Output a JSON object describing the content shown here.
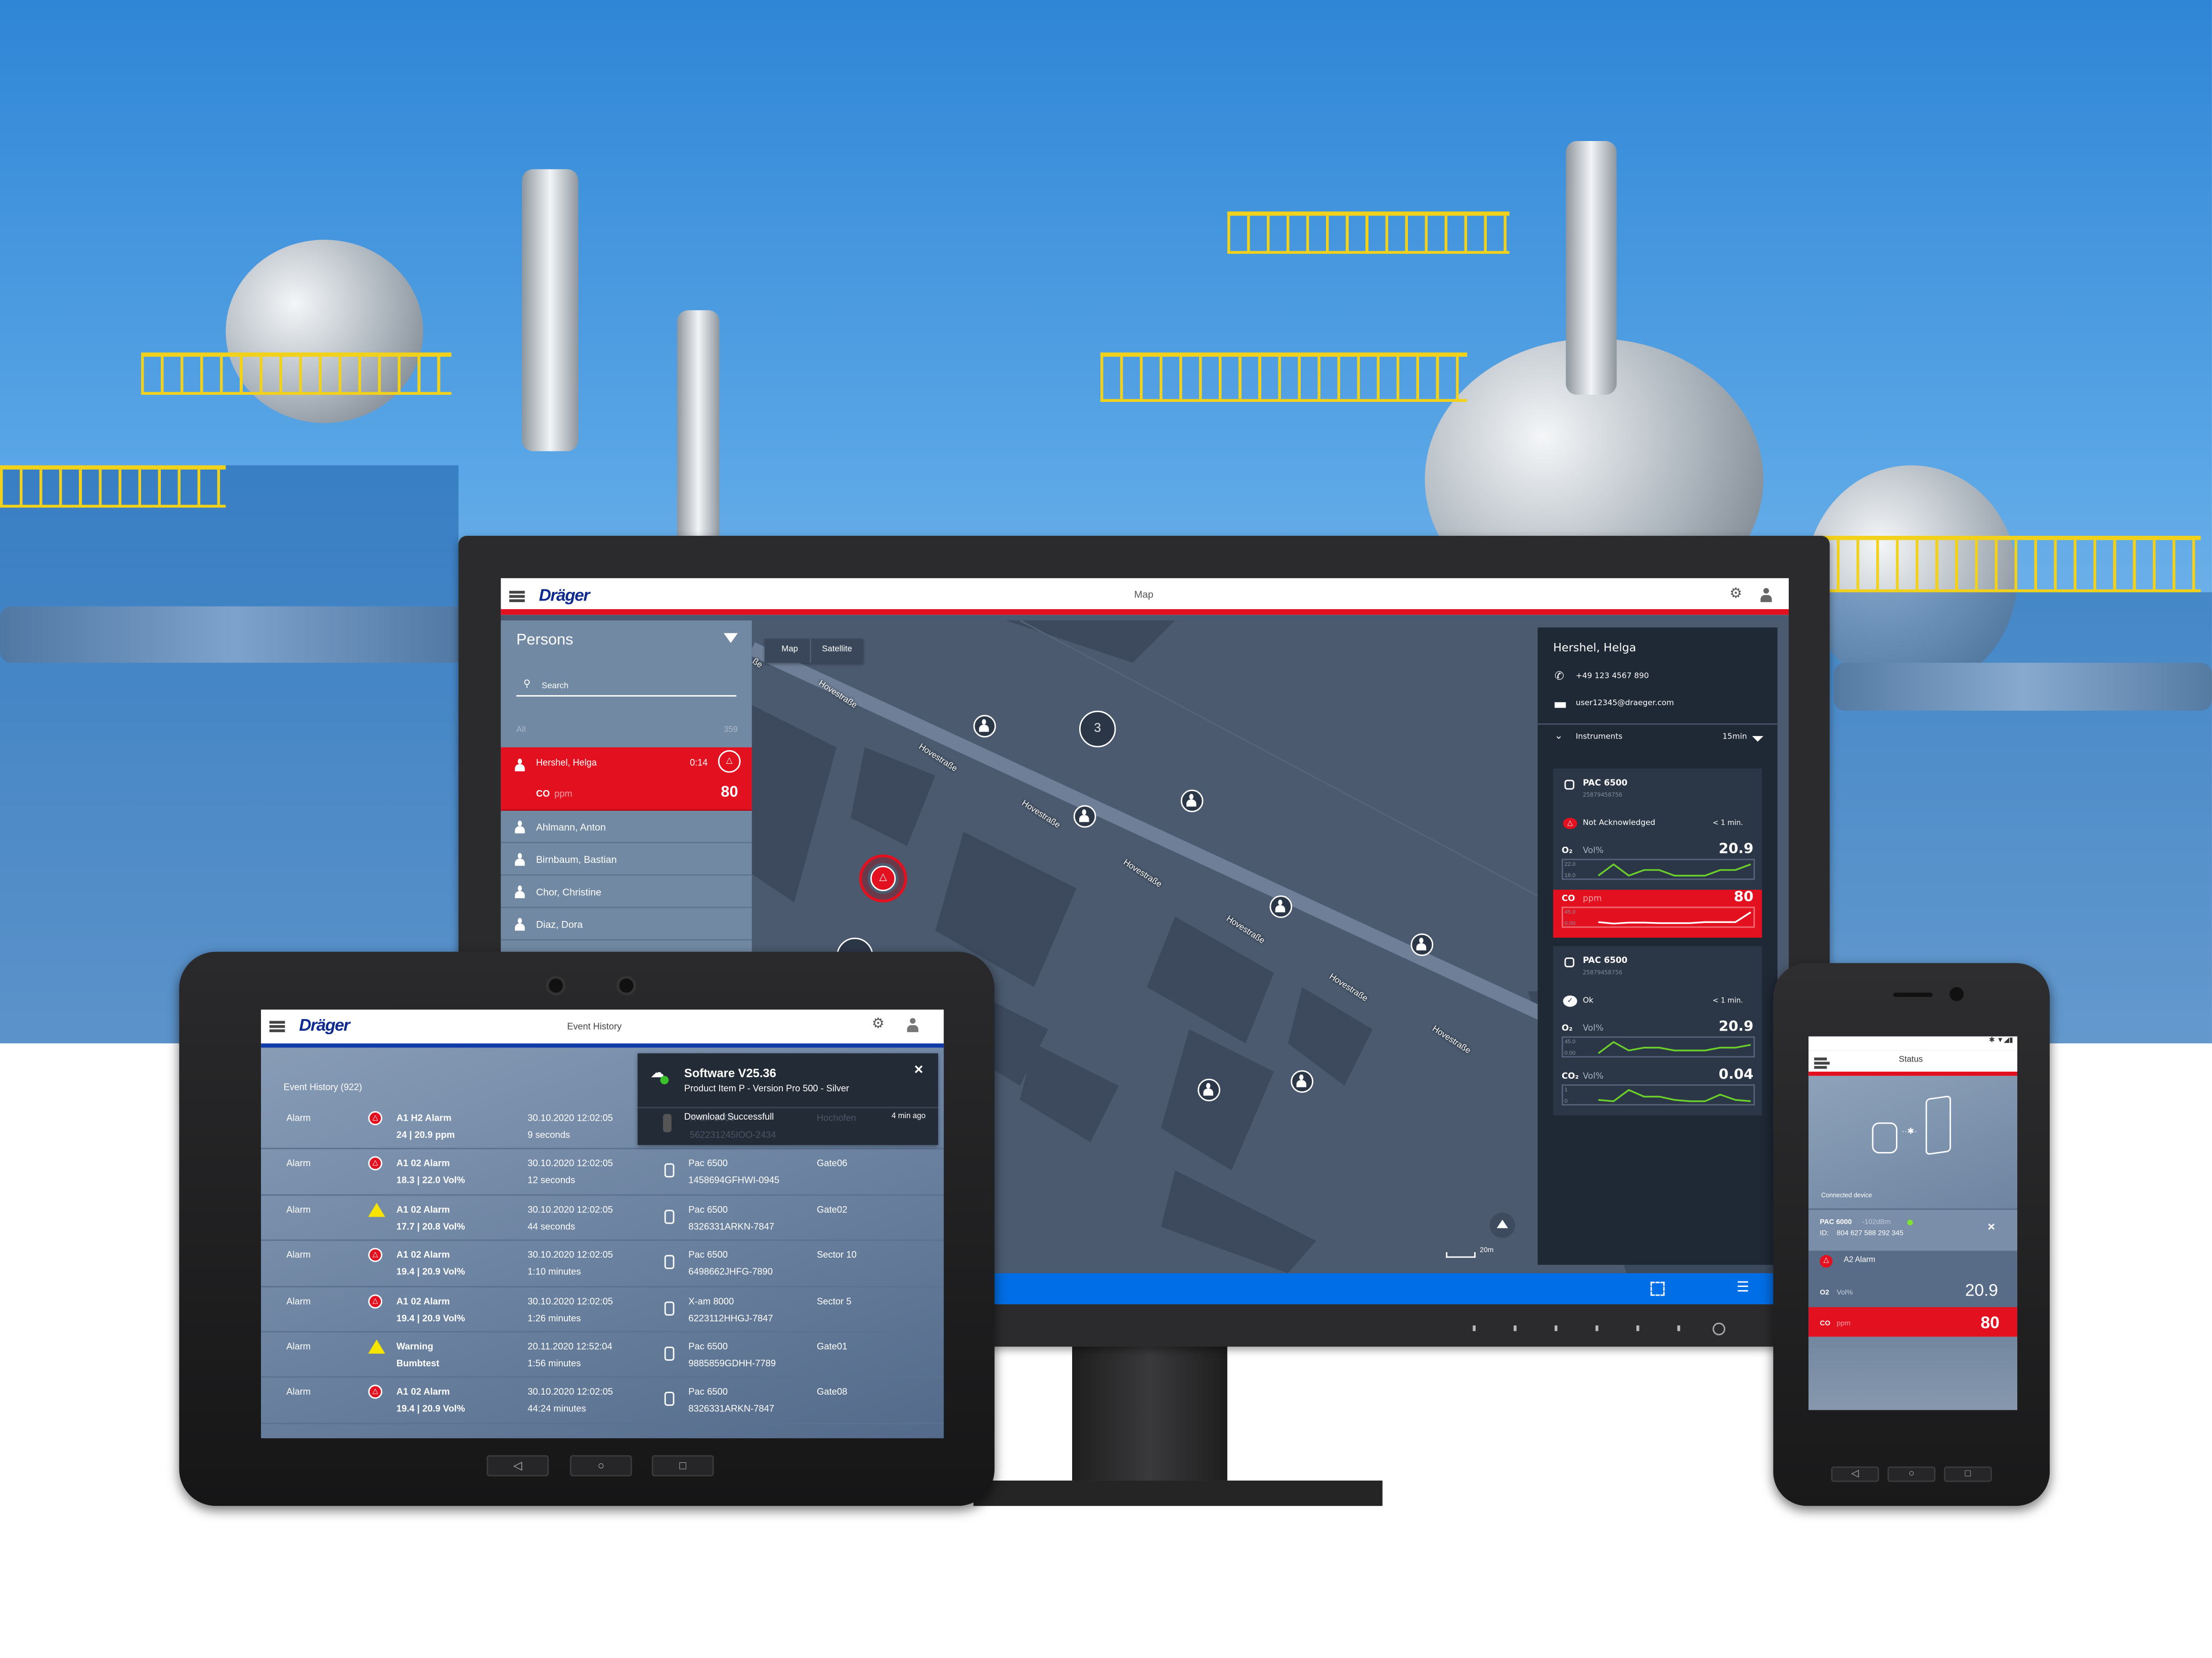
{
  "monitor": {
    "logo": "Dräger",
    "header_title": "Map",
    "persons": {
      "title": "Persons",
      "search_placeholder": "Search",
      "filter_label": "All",
      "count": "359",
      "active": {
        "name": "Hershel, Helga",
        "time": "0:14",
        "gas": "CO",
        "unit": "ppm",
        "value": "80"
      },
      "items": [
        "Ahlmann, Anton",
        "Birnbaum, Bastian",
        "Chor, Christine",
        "Diaz, Dora"
      ]
    },
    "map": {
      "tabs": [
        "Map",
        "Satellite"
      ],
      "street": "Hovestraße",
      "street_partial": "ße",
      "cluster_count": "3",
      "scale_label": "20m",
      "alarm_marker": "A2"
    },
    "detail": {
      "name": "Hershel, Helga",
      "phone": "+49 123 4567 890",
      "email": "user12345@draeger.com",
      "instruments_label": "Instruments",
      "interval": "15min",
      "cards": [
        {
          "device": "PAC 6500",
          "serial": "25879458756",
          "status": "Not Acknowledged",
          "status_type": "alarm",
          "age": "< 1 min.",
          "channels": [
            {
              "gas": "O₂",
              "unit": "Vol%",
              "value": "20.9",
              "max": "22.0",
              "min": "18.0",
              "alarm": false,
              "trend": [
                20.6,
                20.8,
                20.6,
                20.7,
                20.7,
                20.6,
                20.6,
                20.6,
                20.7,
                20.7,
                20.8
              ]
            },
            {
              "gas": "CO",
              "unit": "ppm",
              "value": "80",
              "max": "45.0",
              "min": "0.00",
              "alarm": true,
              "trend": [
                18,
                15,
                17,
                17,
                16,
                16,
                16,
                18,
                18,
                18,
                38
              ]
            }
          ]
        },
        {
          "device": "PAC 6500",
          "serial": "25879458756",
          "status": "Ok",
          "status_type": "ok",
          "age": "< 1 min.",
          "channels": [
            {
              "gas": "O₂",
              "unit": "Vol%",
              "value": "20.9",
              "max": "45.0",
              "min": "0.00",
              "alarm": false,
              "trend": [
                20,
                24,
                21,
                22,
                22,
                21,
                21,
                21,
                22,
                22,
                23
              ]
            },
            {
              "gas": "CO₂",
              "unit": "Vol%",
              "value": "0.04",
              "max": "1",
              "min": "0",
              "alarm": false,
              "trend": [
                0.2,
                0.18,
                0.35,
                0.25,
                0.25,
                0.2,
                0.18,
                0.18,
                0.28,
                0.2,
                0.18
              ]
            }
          ]
        }
      ]
    },
    "colors": {
      "brand_blue": "#0f2a8f",
      "alarm_red": "#e3101f",
      "action_blue": "#006ee6",
      "trend_green": "#6bd02a"
    }
  },
  "tablet": {
    "logo": "Dräger",
    "header_title": "Event History",
    "list_title": "Event History (922)",
    "notification": {
      "title": "Software V25.36",
      "subtitle": "Product Item P - Version Pro 500 - Silver",
      "message": "Download Successfull",
      "time": "4 min ago",
      "ghost_device": "X-am 2000",
      "ghost_serial": "562231245IOO-2434",
      "ghost_location": "Hochofen"
    },
    "rows": [
      {
        "type": "Alarm",
        "icon": "alarm-a1",
        "title": "A1 H2 Alarm",
        "detail": "24 | 20.9 ppm",
        "date": "30.10.2020 12:02:05",
        "duration": "9 seconds",
        "device": "",
        "serial": "",
        "location": ""
      },
      {
        "type": "Alarm",
        "icon": "alarm-a1",
        "title": "A1 02 Alarm",
        "detail": "18.3 | 22.0 Vol%",
        "date": "30.10.2020 12:02:05",
        "duration": "12 seconds",
        "device": "Pac 6500",
        "serial": "1458694GFHWI-0945",
        "location": "Gate06"
      },
      {
        "type": "Alarm",
        "icon": "warning",
        "title": "A1 02 Alarm",
        "detail": "17.7 | 20.8 Vol%",
        "date": "30.10.2020 12:02:05",
        "duration": "44 seconds",
        "device": "Pac 6500",
        "serial": "8326331ARKN-7847",
        "location": "Gate02"
      },
      {
        "type": "Alarm",
        "icon": "alarm-a1",
        "title": "A1 02 Alarm",
        "detail": "19.4 | 20.9 Vol%",
        "date": "30.10.2020 12:02:05",
        "duration": "1:10 minutes",
        "device": "Pac 6500",
        "serial": "6498662JHFG-7890",
        "location": "Sector 10"
      },
      {
        "type": "Alarm",
        "icon": "alarm-a1",
        "title": "A1 02 Alarm",
        "detail": "19.4 | 20.9 Vol%",
        "date": "30.10.2020 12:02:05",
        "duration": "1:26 minutes",
        "device": "X-am 8000",
        "serial": "6223112HHGJ-7847",
        "location": "Sector 5"
      },
      {
        "type": "Alarm",
        "icon": "warning",
        "title": "Warning",
        "detail": "Bumbtest",
        "date": "20.11.2020 12:52:04",
        "duration": "1:56 minutes",
        "device": "Pac 6500",
        "serial": "9885859GDHH-7789",
        "location": "Gate01"
      },
      {
        "type": "Alarm",
        "icon": "alarm-a1",
        "title": "A1 02 Alarm",
        "detail": "19.4 | 20.9 Vol%",
        "date": "30.10.2020 12:02:05",
        "duration": "44:24 minutes",
        "device": "Pac 6500",
        "serial": "8326331ARKN-7847",
        "location": "Gate08"
      }
    ],
    "nav": [
      "◁",
      "○",
      "□"
    ]
  },
  "phone": {
    "header_title": "Status",
    "connected_label": "Connected device",
    "device": "PAC 6000",
    "signal": "-102dBm",
    "id_label": "ID:",
    "id": "804 627 588 292 345",
    "alarm": "A2 Alarm",
    "o2": {
      "gas": "O2",
      "unit": "Vol%",
      "value": "20.9"
    },
    "co": {
      "gas": "CO",
      "unit": "ppm",
      "value": "80"
    },
    "nav": [
      "◁",
      "○",
      "□"
    ]
  }
}
